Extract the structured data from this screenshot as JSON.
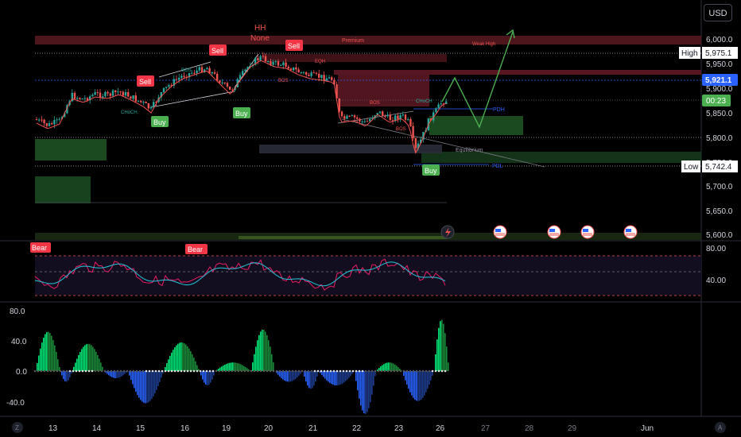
{
  "currency": "USD",
  "price_axis": {
    "ticks": [
      "6,000.0",
      "5,950.0",
      "5,900.0",
      "5,850.0",
      "5,800.0",
      "5,750.0",
      "5,700.0",
      "5,650.0",
      "5,600.0"
    ],
    "high_label": "High",
    "high_value": "5,975.1",
    "current_value": "5,921.1",
    "countdown": "00:23",
    "low_label": "Low",
    "low_value": "5,742.4"
  },
  "rsi_axis": {
    "ticks": [
      "80.00",
      "40.00"
    ]
  },
  "mom_axis": {
    "ticks": [
      "80.0",
      "40.0",
      "0.0",
      "-40.0"
    ]
  },
  "time_axis": {
    "labels": [
      "13",
      "14",
      "15",
      "16",
      "19",
      "20",
      "21",
      "22",
      "23",
      "26",
      "27",
      "28",
      "29",
      "Jun"
    ],
    "left_btn": "Z",
    "right_btn": "A"
  },
  "annotations": {
    "hh": "HH",
    "none": "None",
    "premium": "Premium",
    "weak_high": "Weak High",
    "pdh": "PDH",
    "pdl": "PDL",
    "equilibrium": "Equilibrium",
    "eqh": "EQH",
    "sell": "Sell",
    "buy": "Buy",
    "bear": "Bear",
    "choch": "CHoCH",
    "bos": "BOS"
  },
  "colors": {
    "background": "#000000",
    "bull": "#26a69a",
    "bear": "#ef5350",
    "sell_tag": "#f23645",
    "buy_tag": "#4caf50",
    "current_price": "#2962ff",
    "countdown_bg": "#4caf50",
    "rsi_line": "#26c6da",
    "rsi_price": "#e91e63",
    "mom_pos": "#00e676",
    "mom_neg": "#2962ff"
  },
  "icons": {
    "flag": "us-flag-icon",
    "lightning": "lightning-icon"
  }
}
